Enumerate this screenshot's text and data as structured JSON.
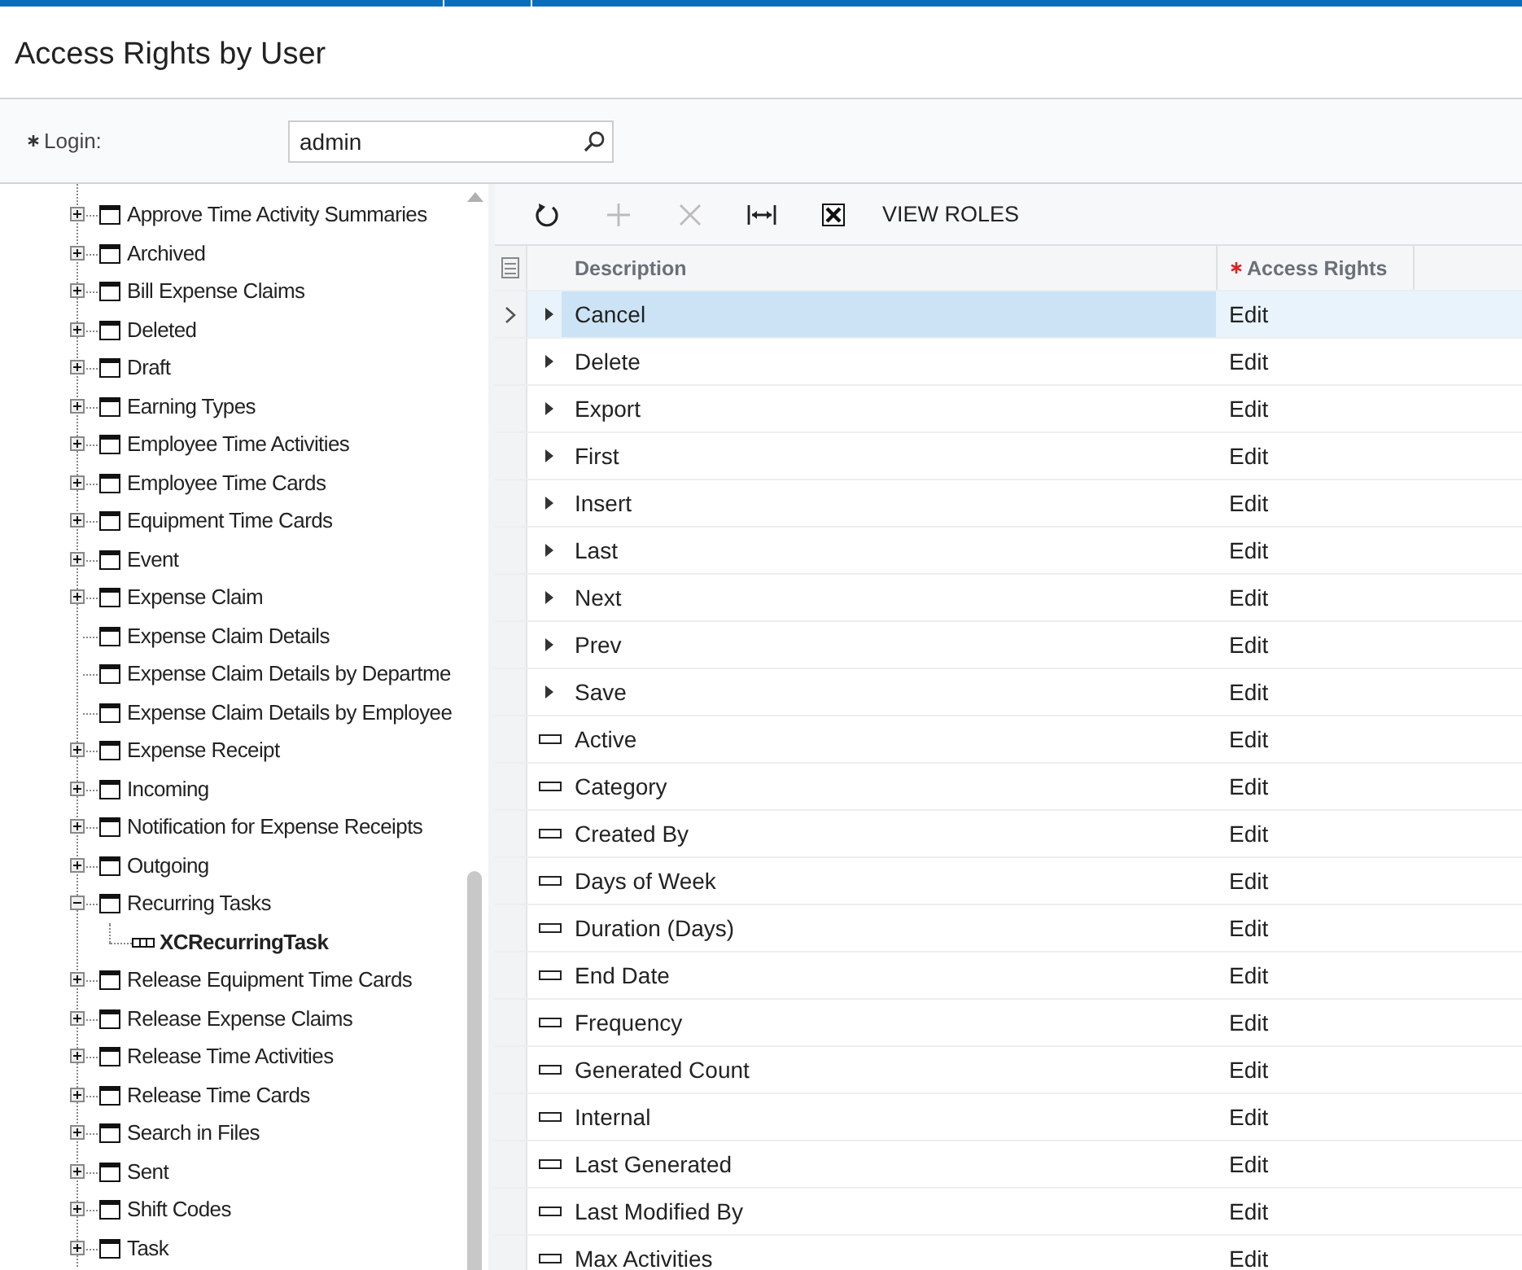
{
  "title": "Access Rights by User",
  "login": {
    "label": "Login:",
    "required": true,
    "value": "admin"
  },
  "tree": [
    {
      "label": "Approve Time Activity Summaries",
      "kind": "folder",
      "expanded": false
    },
    {
      "label": "Archived",
      "kind": "folder",
      "expanded": false
    },
    {
      "label": "Bill Expense Claims",
      "kind": "folder",
      "expanded": false
    },
    {
      "label": "Deleted",
      "kind": "folder",
      "expanded": false
    },
    {
      "label": "Draft",
      "kind": "folder",
      "expanded": false
    },
    {
      "label": "Earning Types",
      "kind": "folder",
      "expanded": false
    },
    {
      "label": "Employee Time Activities",
      "kind": "folder",
      "expanded": false
    },
    {
      "label": "Employee Time Cards",
      "kind": "folder",
      "expanded": false
    },
    {
      "label": "Equipment Time Cards",
      "kind": "folder",
      "expanded": false
    },
    {
      "label": "Event",
      "kind": "folder",
      "expanded": false
    },
    {
      "label": "Expense Claim",
      "kind": "folder",
      "expanded": false
    },
    {
      "label": "Expense Claim Details",
      "kind": "leaf"
    },
    {
      "label": "Expense Claim Details by Departme",
      "kind": "leaf"
    },
    {
      "label": "Expense Claim Details by Employee",
      "kind": "leaf"
    },
    {
      "label": "Expense Receipt",
      "kind": "folder",
      "expanded": false
    },
    {
      "label": "Incoming",
      "kind": "folder",
      "expanded": false
    },
    {
      "label": "Notification for Expense Receipts",
      "kind": "folder",
      "expanded": false
    },
    {
      "label": "Outgoing",
      "kind": "folder",
      "expanded": false
    },
    {
      "label": "Recurring Tasks",
      "kind": "folder",
      "expanded": true,
      "children": [
        {
          "label": "XCRecurringTask",
          "kind": "entity"
        }
      ]
    },
    {
      "label": "Release Equipment Time Cards",
      "kind": "folder",
      "expanded": false
    },
    {
      "label": "Release Expense Claims",
      "kind": "folder",
      "expanded": false
    },
    {
      "label": "Release Time Activities",
      "kind": "folder",
      "expanded": false
    },
    {
      "label": "Release Time Cards",
      "kind": "folder",
      "expanded": false
    },
    {
      "label": "Search in Files",
      "kind": "folder",
      "expanded": false
    },
    {
      "label": "Sent",
      "kind": "folder",
      "expanded": false
    },
    {
      "label": "Shift Codes",
      "kind": "folder",
      "expanded": false
    },
    {
      "label": "Task",
      "kind": "folder",
      "expanded": false
    }
  ],
  "toolbar": {
    "add_disabled": true,
    "delete_disabled": true,
    "view_roles": "VIEW ROLES"
  },
  "grid": {
    "columns": [
      {
        "label": "Description",
        "required": false
      },
      {
        "label": "Access Rights",
        "required": true
      }
    ],
    "rows": [
      {
        "kind": "action",
        "description": "Cancel",
        "rights": "Edit",
        "selected": true
      },
      {
        "kind": "action",
        "description": "Delete",
        "rights": "Edit",
        "selected": false
      },
      {
        "kind": "action",
        "description": "Export",
        "rights": "Edit",
        "selected": false
      },
      {
        "kind": "action",
        "description": "First",
        "rights": "Edit",
        "selected": false
      },
      {
        "kind": "action",
        "description": "Insert",
        "rights": "Edit",
        "selected": false
      },
      {
        "kind": "action",
        "description": "Last",
        "rights": "Edit",
        "selected": false
      },
      {
        "kind": "action",
        "description": "Next",
        "rights": "Edit",
        "selected": false
      },
      {
        "kind": "action",
        "description": "Prev",
        "rights": "Edit",
        "selected": false
      },
      {
        "kind": "action",
        "description": "Save",
        "rights": "Edit",
        "selected": false
      },
      {
        "kind": "field",
        "description": "Active",
        "rights": "Edit",
        "selected": false
      },
      {
        "kind": "field",
        "description": "Category",
        "rights": "Edit",
        "selected": false
      },
      {
        "kind": "field",
        "description": "Created By",
        "rights": "Edit",
        "selected": false
      },
      {
        "kind": "field",
        "description": "Days of Week",
        "rights": "Edit",
        "selected": false
      },
      {
        "kind": "field",
        "description": "Duration (Days)",
        "rights": "Edit",
        "selected": false
      },
      {
        "kind": "field",
        "description": "End Date",
        "rights": "Edit",
        "selected": false
      },
      {
        "kind": "field",
        "description": "Frequency",
        "rights": "Edit",
        "selected": false
      },
      {
        "kind": "field",
        "description": "Generated Count",
        "rights": "Edit",
        "selected": false
      },
      {
        "kind": "field",
        "description": "Internal",
        "rights": "Edit",
        "selected": false
      },
      {
        "kind": "field",
        "description": "Last Generated",
        "rights": "Edit",
        "selected": false
      },
      {
        "kind": "field",
        "description": "Last Modified By",
        "rights": "Edit",
        "selected": false
      },
      {
        "kind": "field",
        "description": "Max Activities",
        "rights": "Edit",
        "selected": false
      }
    ]
  }
}
